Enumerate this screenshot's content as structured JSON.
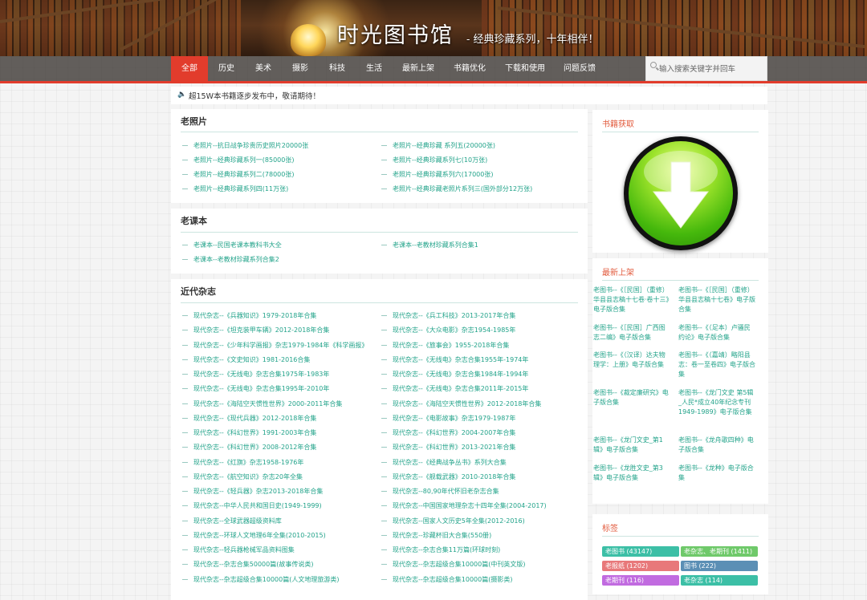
{
  "header": {
    "title": "时光图书馆",
    "subtitle": "- 经典珍藏系列，十年相伴！"
  },
  "nav": {
    "items": [
      "全部",
      "历史",
      "美术",
      "摄影",
      "科技",
      "生活",
      "最新上架",
      "书籍优化",
      "下载和使用",
      "问题反馈"
    ],
    "active": "全部"
  },
  "search": {
    "placeholder": "输入搜索关键字并回车"
  },
  "notice": {
    "text": "超15W本书籍逐步发布中，敬请期待！"
  },
  "sections": [
    {
      "title": "老照片",
      "links": [
        "老照片--抗日战争珍贵历史照片20000张",
        "老照片--经典珍藏 系列五(20000张)",
        "老照片--经典珍藏系列一(85000张)",
        "老照片--经典珍藏系列七(10万张)",
        "老照片--经典珍藏系列二(78000张)",
        "老照片--经典珍藏系列六(17000张)",
        "老照片--经典珍藏系列四(11万张)",
        "老照片--经典珍藏老照片系列三(国外部分12万张)"
      ]
    },
    {
      "title": "老课本",
      "links": [
        "老课本--民国老课本教科书大全",
        "老课本--老教材珍藏系列合集1",
        "老课本--老教材珍藏系列合集2"
      ]
    },
    {
      "title": "近代杂志",
      "links": [
        "现代杂志--《兵器知识》1979-2018年合集",
        "现代杂志--《兵工科技》2013-2017年合集",
        "现代杂志--《坦克装甲车辆》2012-2018年合集",
        "现代杂志--《大众电影》杂志1954-1985年",
        "现代杂志--《少年科学画报》杂志1979-1984年《科学画报》",
        "现代杂志--《旅事会》1955-2018年合集",
        "现代杂志--《文史知识》1981-2016合集",
        "现代杂志--《无线电》杂志合集1955年-1974年",
        "现代杂志--《无线电》杂志合集1975年-1983年",
        "现代杂志--《无线电》杂志合集1984年-1994年",
        "现代杂志--《无线电》杂志合集1995年-2010年",
        "现代杂志--《无线电》杂志合集2011年-2015年",
        "现代杂志--《海陆空天惯性世界》2000-2011年合集",
        "现代杂志--《海陆空天惯性世界》2012-2018年合集",
        "现代杂志--《现代兵器》2012-2018年合集",
        "现代杂志--《电影故事》杂志1979-1987年",
        "现代杂志--《科幻世界》1991-2003年合集",
        "现代杂志--《科幻世界》2004-2007年合集",
        "现代杂志--《科幻世界》2008-2012年合集",
        "现代杂志--《科幻世界》2013-2021年合集",
        "现代杂志--《红旗》杂志1958-1976年",
        "现代杂志--《经典战争丛书》系列大合集",
        "现代杂志--《航空知识》杂志20年全集",
        "现代杂志--《舰载武器》2010-2018年合集",
        "现代杂志--《轻兵器》杂志2013-2018年合集",
        "现代杂志--80,90年代怀旧老杂志合集",
        "现代杂志--中华人民共和国日史(1949-1999)",
        "现代杂志--中国国家地理杂志十四年全集(2004-2017)",
        "现代杂志--全球武器超级资料库",
        "现代杂志--国家人文历史5年全集(2012-2016)",
        "现代杂志--环球人文地理6年全集(2010-2015)",
        "现代杂志--珍藏杯旧大合集(550册)",
        "现代杂志--轻兵器枪械军品资料图集",
        "现代杂志--杂志合集11万篇(环球时刻)",
        "现代杂志--杂志合集50000篇(故事传说类)",
        "现代杂志--杂志超级合集10000篇(中刊英文版)",
        "现代杂志--杂志超级合集10000篇(人文地理旅游类)",
        "现代杂志--杂志超级合集10000篇(摄影类)"
      ]
    }
  ],
  "sidebar": {
    "download": {
      "title": "书籍获取"
    },
    "latest": {
      "title": "最新上架",
      "items": [
        "老图书--《［民国］（重修）华县县志稿十七卷·卷十三》电子版合集",
        "老图书--《［民国］（重修）华县县志稿十七卷》电子版合集",
        "老图书--《［民国］广西图志二编》电子版合集",
        "老图书--《（足本）卢骚民约论》电子版合集",
        "老图书--《（汉译）达夫物理学：上册》电子版合集",
        "老图书--《（嘉靖）略阳县志：卷一至卷四》电子版合集",
        "老图书--《裁定廉研究》电子版合集",
        "老图书--《龙门文史 第5辑_人民*成立40年纪念专刊1949-1989》电子版合集",
        "老图书--《龙门文史_第1辑》电子版合集",
        "老图书--《龙舟歌四种》电子版合集",
        "老图书--《龙胜文史_第3辑》电子版合集",
        "老图书--《龙种》电子版合集"
      ]
    },
    "tags": {
      "title": "标签",
      "items": [
        {
          "label": "老图书 (43147)",
          "color": "#3cbfa6"
        },
        {
          "label": "老杂志、老期刊 (1411)",
          "color": "#6fc96a"
        },
        {
          "label": "老报纸 (1202)",
          "color": "#e8787a"
        },
        {
          "label": "图书 (222)",
          "color": "#5b8fb5"
        },
        {
          "label": "老期刊 (116)",
          "color": "#c16be0"
        },
        {
          "label": "老杂志 (114)",
          "color": "#3cbfa6"
        }
      ]
    }
  }
}
